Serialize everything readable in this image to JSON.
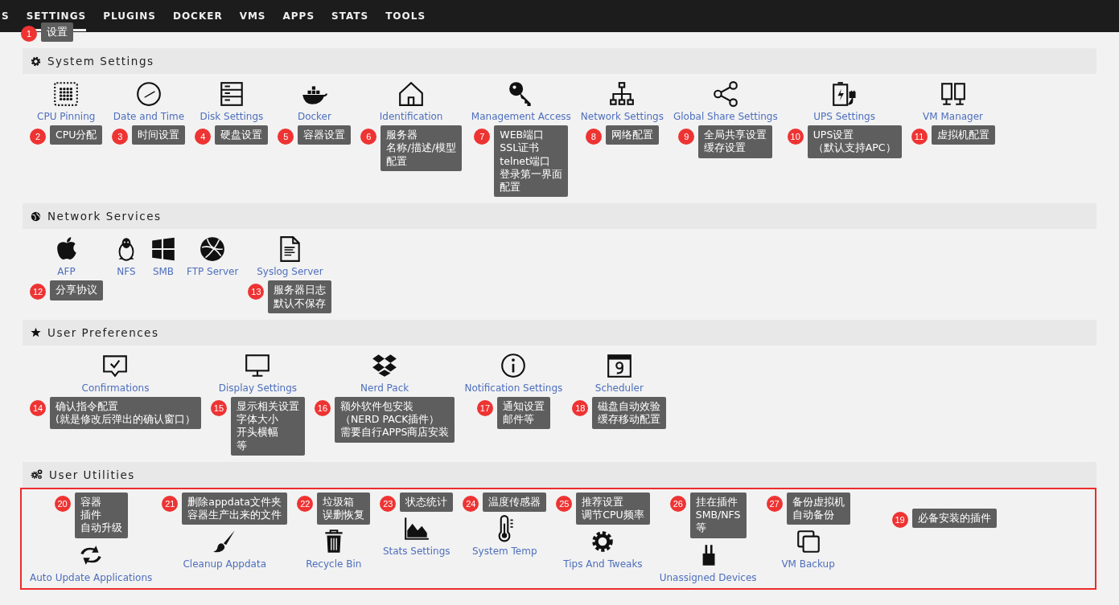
{
  "nav": {
    "items": [
      {
        "label": "S",
        "selected": false
      },
      {
        "label": "SETTINGS",
        "selected": true
      },
      {
        "label": "PLUGINS",
        "selected": false
      },
      {
        "label": "DOCKER",
        "selected": false
      },
      {
        "label": "VMS",
        "selected": false
      },
      {
        "label": "APPS",
        "selected": false
      },
      {
        "label": "STATS",
        "selected": false
      },
      {
        "label": "TOOLS",
        "selected": false
      }
    ]
  },
  "nav_note": {
    "number": "1",
    "lines": [
      "设置"
    ]
  },
  "sections": [
    {
      "title": "System Settings",
      "outlined": false,
      "items": [
        {
          "label": "CPU Pinning",
          "note": {
            "number": "2",
            "lines": [
              "CPU分配"
            ]
          }
        },
        {
          "label": "Date and Time",
          "note": {
            "number": "3",
            "lines": [
              "时间设置"
            ]
          }
        },
        {
          "label": "Disk Settings",
          "note": {
            "number": "4",
            "lines": [
              "硬盘设置"
            ]
          }
        },
        {
          "label": "Docker",
          "note": {
            "number": "5",
            "lines": [
              "容器设置"
            ]
          }
        },
        {
          "label": "Identification",
          "note": {
            "number": "6",
            "lines": [
              "服务器",
              "名称/描述/模型",
              "配置"
            ]
          }
        },
        {
          "label": "Management Access",
          "note": {
            "number": "7",
            "lines": [
              "WEB端口",
              "SSL证书",
              "telnet端口",
              "登录第一界面",
              "配置"
            ]
          }
        },
        {
          "label": "Network Settings",
          "note": {
            "number": "8",
            "lines": [
              "网络配置"
            ]
          }
        },
        {
          "label": "Global Share Settings",
          "note": {
            "number": "9",
            "lines": [
              "全局共享设置",
              "缓存设置"
            ]
          }
        },
        {
          "label": "UPS Settings",
          "note": {
            "number": "10",
            "lines": [
              "UPS设置",
              "（默认支持APC）"
            ]
          }
        },
        {
          "label": "VM Manager",
          "note": {
            "number": "11",
            "lines": [
              "虚拟机配置"
            ]
          }
        }
      ]
    },
    {
      "title": "Network Services",
      "outlined": false,
      "items": [
        {
          "label": "AFP",
          "note": {
            "number": "12",
            "lines": [
              "分享协议"
            ]
          }
        },
        {
          "label": "NFS"
        },
        {
          "label": "SMB"
        },
        {
          "label": "FTP Server"
        },
        {
          "label": "Syslog Server",
          "note": {
            "number": "13",
            "lines": [
              "服务器日志",
              "默认不保存"
            ]
          }
        }
      ]
    },
    {
      "title": "User Preferences",
      "outlined": false,
      "items": [
        {
          "label": "Confirmations",
          "note": {
            "number": "14",
            "lines": [
              "确认指令配置",
              "(就是修改后弹出的确认窗口）"
            ]
          }
        },
        {
          "label": "Display Settings",
          "note": {
            "number": "15",
            "lines": [
              "显示相关设置",
              "字体大小",
              "开头横幅",
              "等"
            ]
          }
        },
        {
          "label": "Nerd Pack",
          "note": {
            "number": "16",
            "lines": [
              "额外软件包安装",
              "（NERD PACK插件）",
              "需要自行APPS商店安装"
            ]
          }
        },
        {
          "label": "Notification Settings",
          "note": {
            "number": "17",
            "lines": [
              "通知设置",
              "邮件等"
            ]
          }
        },
        {
          "label": "Scheduler",
          "note": {
            "number": "18",
            "lines": [
              "磁盘自动效验",
              "缓存移动配置"
            ]
          }
        }
      ]
    },
    {
      "title": "User Utilities",
      "outlined": true,
      "items": [
        {
          "label": "Auto Update Applications",
          "note": {
            "number": "20",
            "lines": [
              "容器",
              "插件",
              "自动升级"
            ]
          }
        },
        {
          "label": "Cleanup Appdata",
          "note": {
            "number": "21",
            "lines": [
              "删除appdata文件夹",
              "容器生产出来的文件"
            ]
          }
        },
        {
          "label": "Recycle Bin",
          "note": {
            "number": "22",
            "lines": [
              "垃圾箱",
              "误删恢复"
            ]
          }
        },
        {
          "label": "Stats Settings",
          "note": {
            "number": "23",
            "lines": [
              "状态统计"
            ]
          }
        },
        {
          "label": "System Temp",
          "note": {
            "number": "24",
            "lines": [
              "温度传感器"
            ]
          }
        },
        {
          "label": "Tips And Tweaks",
          "note": {
            "number": "25",
            "lines": [
              "推荐设置",
              "调节CPU频率"
            ]
          }
        },
        {
          "label": "Unassigned Devices",
          "note": {
            "number": "26",
            "lines": [
              "挂在插件",
              "SMB/NFS",
              "等"
            ]
          }
        },
        {
          "label": "VM Backup",
          "note": {
            "number": "27",
            "lines": [
              "备份虚拟机",
              "自动备份"
            ]
          }
        }
      ],
      "extra_notes": [
        {
          "number": "19",
          "lines": [
            "必备安装的插件"
          ]
        }
      ]
    }
  ]
}
